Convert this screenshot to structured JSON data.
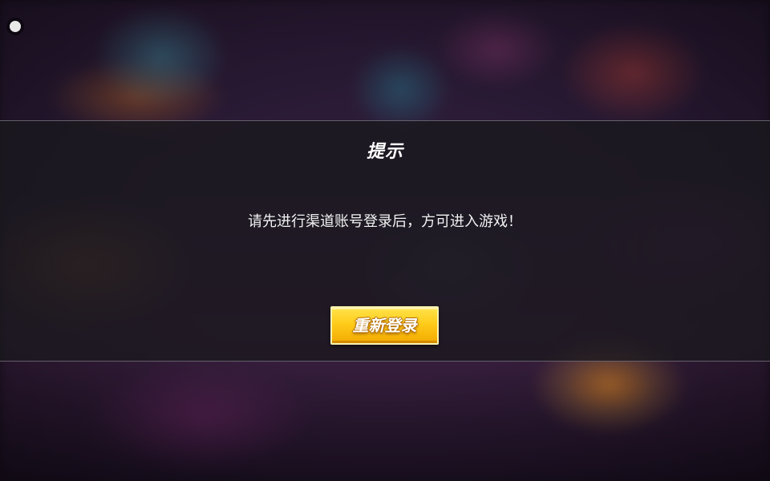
{
  "dialog": {
    "title": "提示",
    "message": "请先进行渠道账号登录后，方可进入游戏！",
    "relogin_label": "重新登录"
  },
  "colors": {
    "button_gradient_top": "#ffe34a",
    "button_gradient_bottom": "#f2a900",
    "overlay": "#1a181e",
    "text": "#ffffff"
  }
}
